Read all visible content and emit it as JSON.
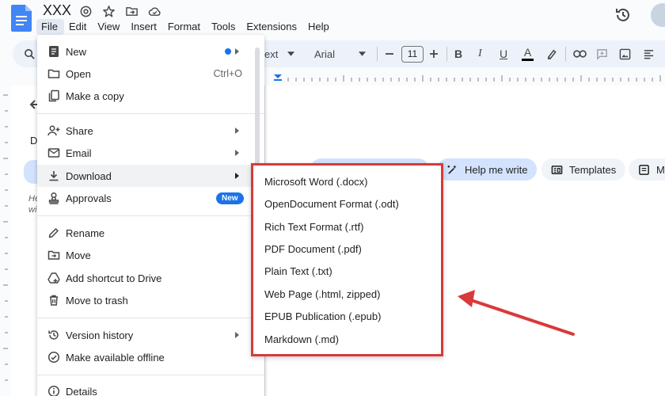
{
  "app": {
    "doc_title": "XXX",
    "colors": {
      "accent": "#1a73e8",
      "annotation": "#d83a3a",
      "toolbar": "#edf2fa"
    }
  },
  "menubar": [
    "File",
    "Edit",
    "View",
    "Insert",
    "Format",
    "Tools",
    "Extensions",
    "Help"
  ],
  "toolbar": {
    "style": "ext",
    "font": "Arial",
    "font_size": "11"
  },
  "file_menu": {
    "items": [
      {
        "label": "New",
        "icon": "doc-icon"
      },
      {
        "label": "Open",
        "icon": "folder-icon",
        "shortcut": "Ctrl+O"
      },
      {
        "label": "Make a copy",
        "icon": "copy-icon"
      },
      {
        "label": "Share",
        "icon": "person-add-icon"
      },
      {
        "label": "Email",
        "icon": "mail-icon"
      },
      {
        "label": "Download",
        "icon": "download-icon"
      },
      {
        "label": "Approvals",
        "icon": "approvals-icon",
        "badge": "New"
      },
      {
        "label": "Rename",
        "icon": "pencil-icon"
      },
      {
        "label": "Move",
        "icon": "move-folder-icon"
      },
      {
        "label": "Add shortcut to Drive",
        "icon": "drive-shortcut-icon"
      },
      {
        "label": "Move to trash",
        "icon": "trash-icon"
      },
      {
        "label": "Version history",
        "icon": "history-icon"
      },
      {
        "label": "Make available offline",
        "icon": "offline-icon"
      },
      {
        "label": "Details",
        "icon": "info-icon"
      }
    ]
  },
  "download_menu": {
    "items": [
      "Microsoft Word (.docx)",
      "OpenDocument Format (.odt)",
      "Rich Text Format (.rtf)",
      "PDF Document (.pdf)",
      "Plain Text (.txt)",
      "Web Page (.html, zipped)",
      "EPUB Publication (.epub)",
      "Markdown (.md)"
    ]
  },
  "chips": {
    "help_me_write": "Help me write",
    "templates": "Templates",
    "more": "M"
  },
  "side_panel": {
    "heading": "D",
    "hint_line1": "He",
    "hint_line2": "wi"
  }
}
